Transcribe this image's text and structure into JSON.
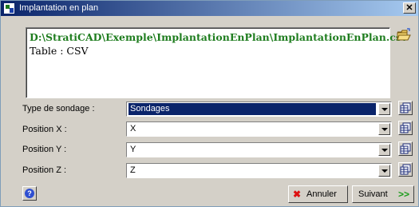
{
  "window": {
    "title": "Implantation en plan",
    "close_label": "✕"
  },
  "file": {
    "path": "D:\\StratiCAD\\Exemple\\ImplantationEnPlan\\ImplantationEnPlan.csv",
    "table_line": "Table : CSV"
  },
  "rows": [
    {
      "label": "Type de sondage :",
      "value": "Sondages"
    },
    {
      "label": "Position X :",
      "value": "X"
    },
    {
      "label": "Position Y :",
      "value": "Y"
    },
    {
      "label": "Position Z :",
      "value": "Z"
    }
  ],
  "buttons": {
    "help": "?",
    "cancel": "Annuler",
    "next": "Suivant",
    "cancel_icon": "✖",
    "next_icon": ">>"
  },
  "icons": {
    "app": "app-icon",
    "folder": "folder-open-icon",
    "grid": "table-grid-icon",
    "help": "help-icon"
  },
  "colors": {
    "title_bar": "#0a246a",
    "path_text": "#1f7d1f",
    "selection": "#0a246a"
  }
}
